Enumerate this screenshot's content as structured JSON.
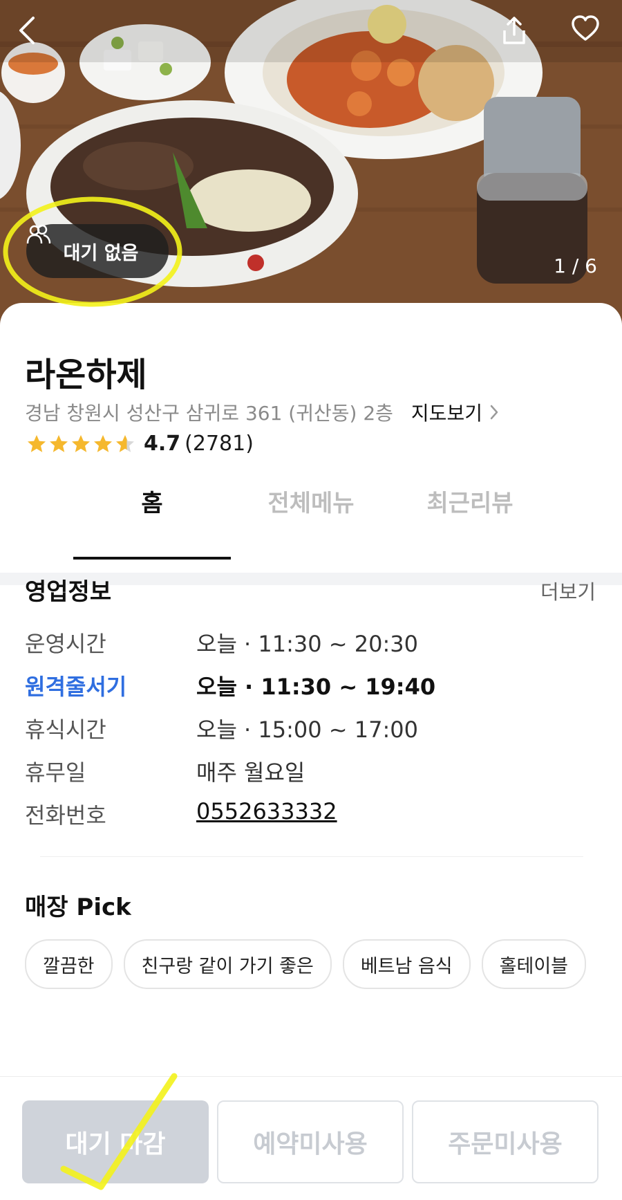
{
  "hero": {
    "wait_badge": "대기 없음",
    "page_counter": "1 / 6"
  },
  "store": {
    "name": "라온하제",
    "address": "경남 창원시 성산구 삼귀로 361 (귀산동) 2층",
    "map_link": "지도보기",
    "rating": "4.7",
    "review_count": "(2781)",
    "star_rating": 4.7
  },
  "tabs": [
    "홈",
    "전체메뉴",
    "최근리뷰"
  ],
  "business_info": {
    "title": "영업정보",
    "more": "더보기",
    "rows": [
      {
        "label": "운영시간",
        "value": "오늘 · 11:30 ~ 20:30"
      },
      {
        "label": "원격줄서기",
        "value": "오늘 · 11:30 ~ 19:40"
      },
      {
        "label": "휴식시간",
        "value": "오늘 · 15:00 ~ 17:00"
      },
      {
        "label": "휴무일",
        "value": "매주 월요일"
      },
      {
        "label": "전화번호",
        "value": "0552633332"
      }
    ]
  },
  "store_pick": {
    "title": "매장 Pick",
    "chips": [
      "깔끔한",
      "친구랑 같이 가기 좋은",
      "베트남 음식",
      "홀테이블"
    ]
  },
  "actions": {
    "wait": "대기 마감",
    "reserve": "예약미사용",
    "order": "주문미사용"
  },
  "colors": {
    "accent_blue": "#2f6ee0",
    "star": "#f5b82e",
    "annotation_yellow": "#f3f21b"
  },
  "icons": [
    "back-chevron-icon",
    "share-icon",
    "heart-icon",
    "people-icon",
    "star-icon",
    "chevron-right-icon"
  ]
}
